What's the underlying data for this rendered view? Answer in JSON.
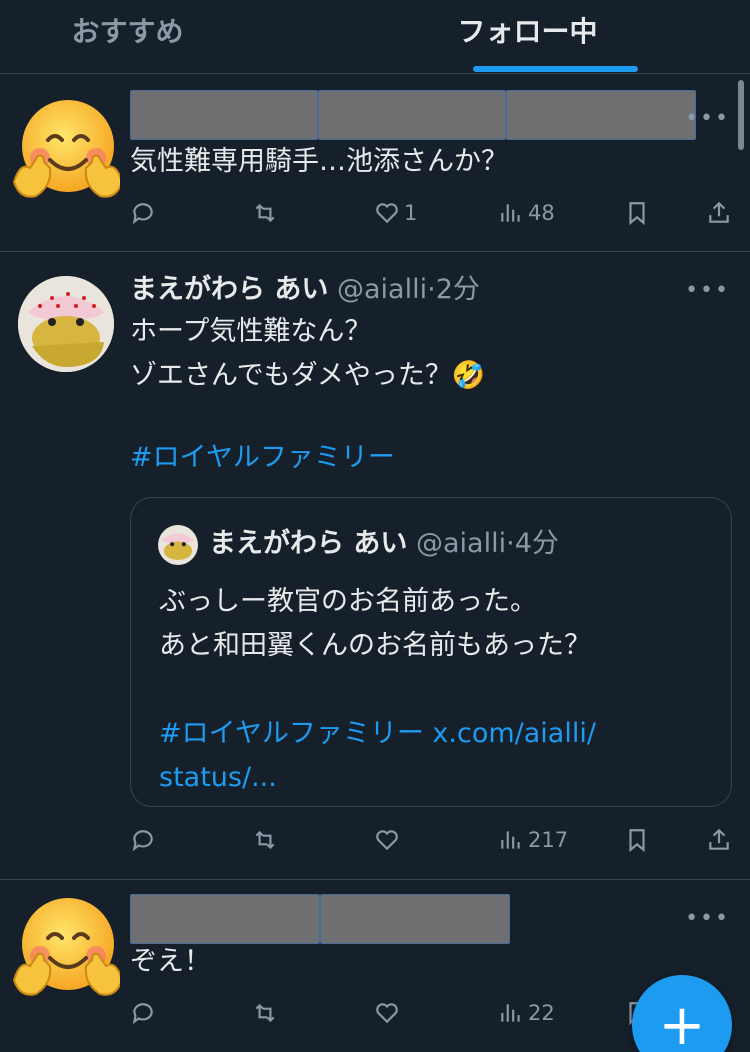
{
  "tabs": [
    {
      "label": "おすすめ",
      "active": false
    },
    {
      "label": "フォロー中",
      "active": true
    }
  ],
  "tweets": [
    {
      "name_redacted": true,
      "text": "気性難専用騎手…池添さんか？",
      "actions": {
        "reply": "",
        "retweet": "",
        "like": "1",
        "views": "48"
      }
    },
    {
      "name": "まえがわら あい",
      "handle": "@aialli",
      "separator": "·",
      "time": "2分",
      "text_lines": [
        "ホープ気性難なん？",
        "ゾエさんでもダメやった？🤣"
      ],
      "hashtag": "#ロイヤルファミリー",
      "quote": {
        "name": "まえがわら あい",
        "handle": "@aialli",
        "separator": "·",
        "time": "4分",
        "text_lines": [
          "ぶっしー教官のお名前あった。",
          "あと和田翼くんのお名前もあった？"
        ],
        "hashtag": "#ロイヤルファミリー",
        "link_part1": "x.com/aialli/",
        "link_part2": "status/..."
      },
      "actions": {
        "reply": "",
        "retweet": "",
        "like": "",
        "views": "217"
      }
    },
    {
      "name_redacted": true,
      "text": "ぞえ！",
      "actions": {
        "reply": "",
        "retweet": "",
        "like": "",
        "views": "22"
      }
    }
  ],
  "more_label": "•••",
  "fab_label": "+",
  "colors": {
    "background": "#15202b",
    "accent": "#1d9bf0",
    "muted": "#8b98a5",
    "divider": "#38444d"
  }
}
